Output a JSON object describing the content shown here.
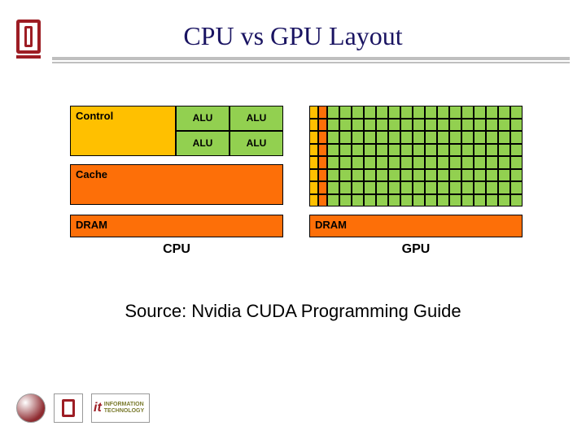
{
  "title": "CPU vs GPU Layout",
  "cpu": {
    "control": "Control",
    "alu_label": "ALU",
    "cache": "Cache",
    "dram": "DRAM",
    "label": "CPU"
  },
  "gpu": {
    "dram": "DRAM",
    "label": "GPU",
    "rows": 8,
    "alus_per_row": 16
  },
  "source": "Source: Nvidia CUDA Programming Guide",
  "footer": {
    "it_label": "INFORMATION TECHNOLOGY"
  },
  "colors": {
    "control": "#ffc000",
    "alu": "#92d050",
    "cache_dram": "#fd6f08",
    "title": "#1a1462",
    "brand_red": "#9d1d24"
  }
}
